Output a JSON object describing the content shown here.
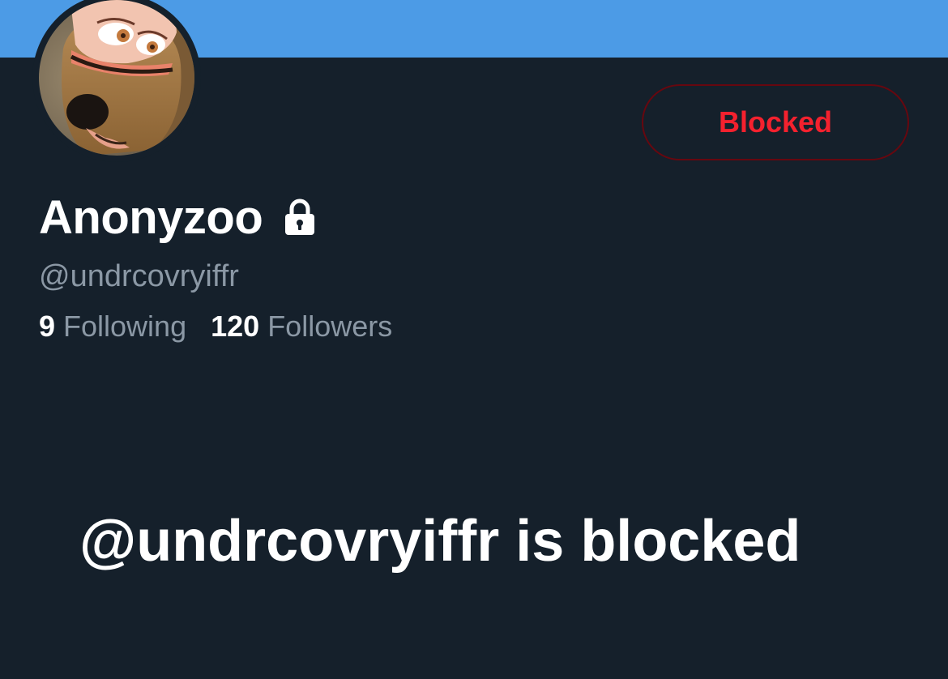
{
  "profile": {
    "display_name": "Anonyzoo",
    "handle": "@undrcovryiffr",
    "protected": true,
    "following_count": "9",
    "following_label": "Following",
    "followers_count": "120",
    "followers_label": "Followers"
  },
  "actions": {
    "blocked_label": "Blocked"
  },
  "blocked_notice": {
    "message": "@undrcovryiffr is blocked"
  },
  "colors": {
    "background": "#15202b",
    "banner": "#4c9be6",
    "blocked_red": "#f4212e",
    "secondary_text": "#8b98a5"
  },
  "icons": {
    "lock": "lock-icon"
  }
}
